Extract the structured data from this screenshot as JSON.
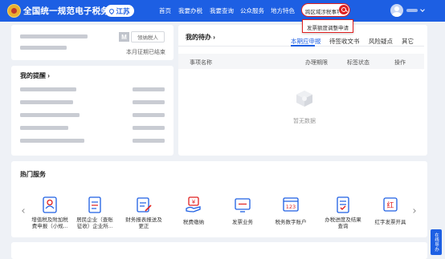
{
  "header": {
    "site_title": "全国统一规范电子税务局",
    "region": "江苏",
    "nav": [
      "首页",
      "我要办税",
      "我要查询",
      "公众服务",
      "地方特色"
    ],
    "search": {
      "value": "跨区域涉税事项申报"
    },
    "user": {
      "name": ""
    }
  },
  "search_suggestion": {
    "item": "发票额度调整申请"
  },
  "profile_card": {
    "badge_letter": "M",
    "badge_button": "领纳税人",
    "deadline": "本月征期已结束"
  },
  "reminder_card": {
    "title": "我的提醒 ›"
  },
  "todo_card": {
    "title": "我的待办 ›",
    "tabs": [
      "本期应申报",
      "待签收文书",
      "风险疑点",
      "其它"
    ],
    "columns": [
      "事项名称",
      "办理期限",
      "标签状态",
      "操作"
    ],
    "empty_text": "暂无数据"
  },
  "services": {
    "title": "热门服务",
    "items": [
      {
        "label_line1": "增值税及附加税",
        "label_line2": "费申报（小规...",
        "icon": "person-doc-icon"
      },
      {
        "label_line1": "居民企业（查账",
        "label_line2": "征收）企业所...",
        "icon": "document-list-icon"
      },
      {
        "label_line1": "财务报表报送及",
        "label_line2": "更正",
        "icon": "report-edit-icon"
      },
      {
        "label_line1": "税费缴纳",
        "label_line2": "",
        "icon": "payment-hand-icon"
      },
      {
        "label_line1": "发票业务",
        "label_line2": "",
        "icon": "invoice-screen-icon"
      },
      {
        "label_line1": "税务数字账户",
        "label_line2": "",
        "icon": "digital-account-icon"
      },
      {
        "label_line1": "办税进度及结果",
        "label_line2": "查询",
        "icon": "progress-doc-icon"
      },
      {
        "label_line1": "红字发票开具",
        "label_line2": "",
        "icon": "red-invoice-icon"
      }
    ]
  },
  "float_tab": {
    "label": "在线导办"
  },
  "colors": {
    "brand": "#1d5fe3",
    "accent": "#e02020"
  }
}
